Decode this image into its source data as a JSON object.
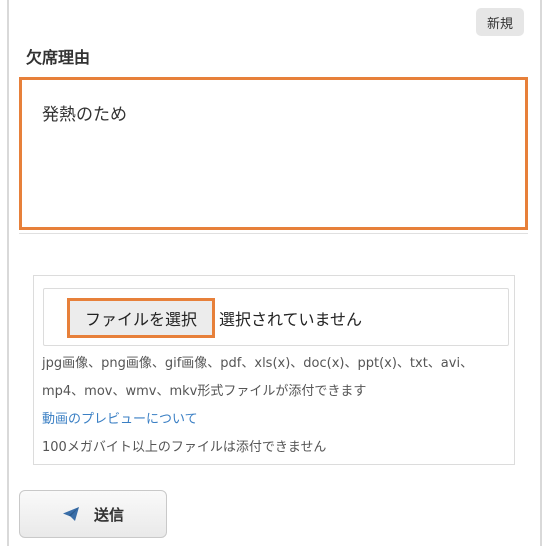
{
  "header": {
    "badge_label": "新規"
  },
  "form": {
    "reason_label": "欠席理由",
    "reason_value": "発熱のため"
  },
  "upload": {
    "choose_button_label": "ファイルを選択",
    "status_text": "選択されていません",
    "formats_line1": "jpg画像、png画像、gif画像、pdf、xls(x)、doc(x)、ppt(x)、txt、avi、",
    "formats_line2": "mp4、mov、wmv、mkv形式ファイルが添付できます",
    "preview_link": "動画のプレビューについて",
    "size_limit": "100メガバイト以上のファイルは添付できません"
  },
  "actions": {
    "send_label": "送信",
    "send_icon": "paper-plane-icon"
  },
  "colors": {
    "highlight": "#e7803a",
    "link": "#3a7fc4"
  }
}
